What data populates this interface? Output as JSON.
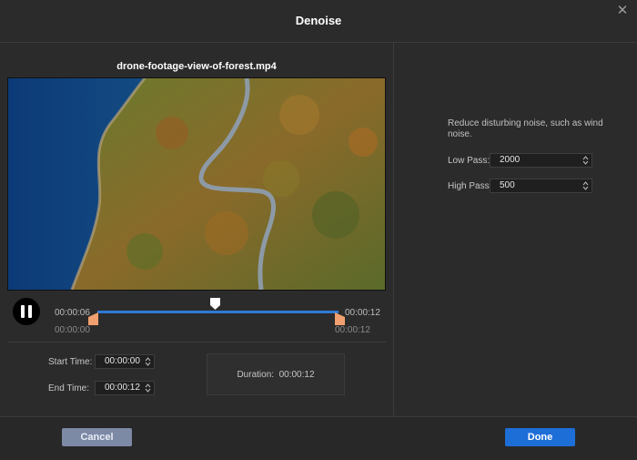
{
  "window": {
    "title": "Denoise",
    "close_glyph": "✕"
  },
  "player": {
    "filename": "drone-footage-view-of-forest.mp4",
    "current_time": "00:00:06",
    "current_time_sub": "00:00:00",
    "end_time": "00:00:12",
    "end_time_sub": "00:00:12",
    "progress_fraction": 0.5
  },
  "trim": {
    "start_label": "Start Time:",
    "start_value": "00:00:00",
    "end_label": "End Time:",
    "end_value": "00:00:12",
    "duration_label": "Duration:",
    "duration_value": "00:00:12"
  },
  "settings": {
    "description": "Reduce disturbing noise, such as wind noise.",
    "low_pass_label": "Low Pass:",
    "low_pass_value": "2000",
    "high_pass_label": "High Pass:",
    "high_pass_value": "500"
  },
  "footer": {
    "cancel_label": "Cancel",
    "done_label": "Done"
  },
  "colors": {
    "accent": "#1e6ed8",
    "track": "#2f7ad6",
    "handle": "#f0a070",
    "cancel": "#7d8aa6"
  },
  "icons": {
    "close": "close-icon",
    "pause": "pause-icon",
    "playhead": "playhead-icon",
    "spinner": "spinner-arrows-icon"
  }
}
